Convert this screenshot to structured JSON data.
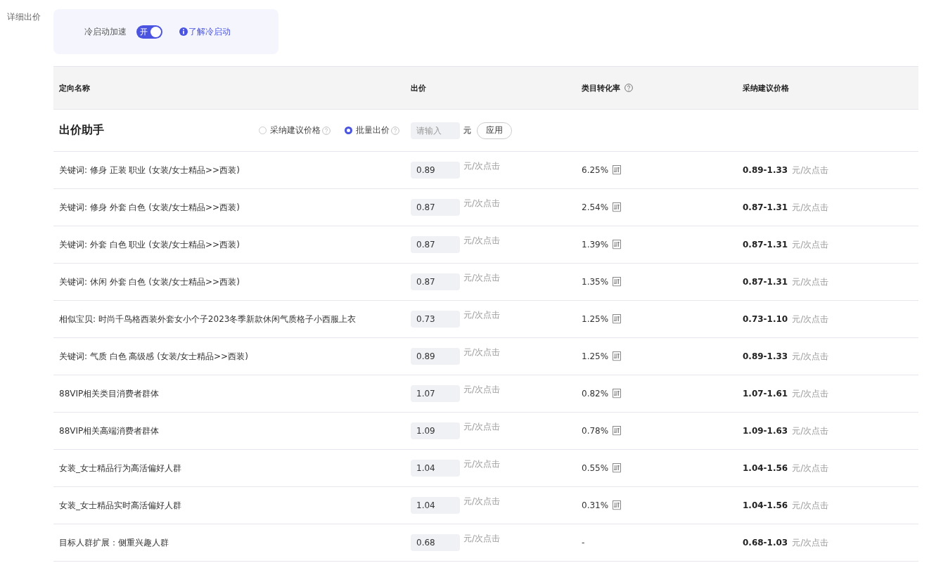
{
  "section_label": "详细出价",
  "cold_start": {
    "label": "冷启动加速",
    "toggle": {
      "on": true,
      "text": "开"
    },
    "link": "了解冷启动"
  },
  "table": {
    "columns": [
      {
        "label": "定向名称",
        "help": false
      },
      {
        "label": "出价",
        "help": false
      },
      {
        "label": "类目转化率",
        "help": true
      },
      {
        "label": "采纳建议价格",
        "help": false
      }
    ],
    "helper": {
      "title": "出价助手",
      "options": [
        {
          "label": "采纳建议价格",
          "selected": false
        },
        {
          "label": "批量出价",
          "selected": true
        }
      ],
      "input": {
        "placeholder": "请输入"
      },
      "unit": "元",
      "button": "应用"
    },
    "rows": [
      {
        "name": "关键词: 修身 正装 职业 (女装/女士精品>>西装)",
        "bid": "0.89",
        "bid_unit": "元/次点击",
        "rate": "6.25%",
        "trend": true,
        "suggest": "0.89-1.33",
        "suggest_unit": "元/次点击"
      },
      {
        "name": "关键词: 修身 外套 白色 (女装/女士精品>>西装)",
        "bid": "0.87",
        "bid_unit": "元/次点击",
        "rate": "2.54%",
        "trend": true,
        "suggest": "0.87-1.31",
        "suggest_unit": "元/次点击"
      },
      {
        "name": "关键词: 外套 白色 职业 (女装/女士精品>>西装)",
        "bid": "0.87",
        "bid_unit": "元/次点击",
        "rate": "1.39%",
        "trend": true,
        "suggest": "0.87-1.31",
        "suggest_unit": "元/次点击"
      },
      {
        "name": "关键词: 休闲 外套 白色 (女装/女士精品>>西装)",
        "bid": "0.87",
        "bid_unit": "元/次点击",
        "rate": "1.35%",
        "trend": true,
        "suggest": "0.87-1.31",
        "suggest_unit": "元/次点击"
      },
      {
        "name": "相似宝贝: 时尚千鸟格西装外套女小个子2023冬季新款休闲气质格子小西服上衣",
        "bid": "0.73",
        "bid_unit": "元/次点击",
        "rate": "1.25%",
        "trend": true,
        "suggest": "0.73-1.10",
        "suggest_unit": "元/次点击"
      },
      {
        "name": "关键词: 气质 白色 高级感 (女装/女士精品>>西装)",
        "bid": "0.89",
        "bid_unit": "元/次点击",
        "rate": "1.25%",
        "trend": true,
        "suggest": "0.89-1.33",
        "suggest_unit": "元/次点击"
      },
      {
        "name": "88VIP相关类目消费者群体",
        "bid": "1.07",
        "bid_unit": "元/次点击",
        "rate": "0.82%",
        "trend": true,
        "suggest": "1.07-1.61",
        "suggest_unit": "元/次点击"
      },
      {
        "name": "88VIP相关高端消费者群体",
        "bid": "1.09",
        "bid_unit": "元/次点击",
        "rate": "0.78%",
        "trend": true,
        "suggest": "1.09-1.63",
        "suggest_unit": "元/次点击"
      },
      {
        "name": "女装_女士精品行为高活偏好人群",
        "bid": "1.04",
        "bid_unit": "元/次点击",
        "rate": "0.55%",
        "trend": true,
        "suggest": "1.04-1.56",
        "suggest_unit": "元/次点击"
      },
      {
        "name": "女装_女士精品实时高活偏好人群",
        "bid": "1.04",
        "bid_unit": "元/次点击",
        "rate": "0.31%",
        "trend": true,
        "suggest": "1.04-1.56",
        "suggest_unit": "元/次点击"
      },
      {
        "name": "目标人群扩展：侧重兴趣人群",
        "bid": "0.68",
        "bid_unit": "元/次点击",
        "rate": "-",
        "trend": false,
        "suggest": "0.68-1.03",
        "suggest_unit": "元/次点击"
      }
    ]
  }
}
